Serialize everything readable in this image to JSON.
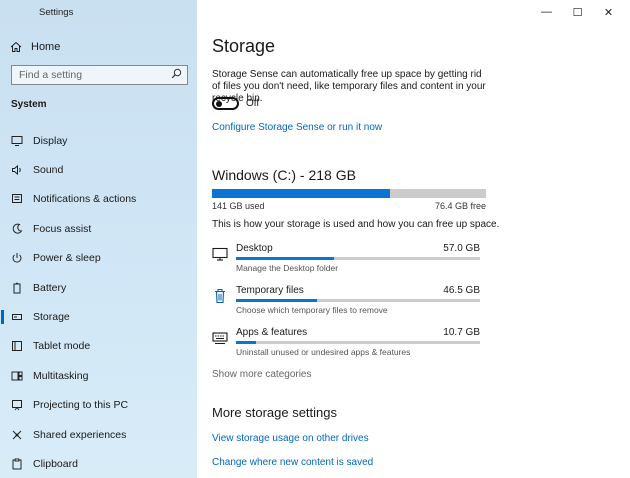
{
  "window": {
    "title": "Settings",
    "controls": {
      "minimize": "—",
      "maximize": "☐",
      "close": "✕"
    }
  },
  "sidebar": {
    "home_label": "Home",
    "search_placeholder": "Find a setting",
    "section_label": "System",
    "items": [
      {
        "label": "Display",
        "icon": "display-icon"
      },
      {
        "label": "Sound",
        "icon": "sound-icon"
      },
      {
        "label": "Notifications & actions",
        "icon": "notifications-icon"
      },
      {
        "label": "Focus assist",
        "icon": "focus-assist-icon"
      },
      {
        "label": "Power & sleep",
        "icon": "power-icon"
      },
      {
        "label": "Battery",
        "icon": "battery-icon"
      },
      {
        "label": "Storage",
        "icon": "storage-icon",
        "active": true
      },
      {
        "label": "Tablet mode",
        "icon": "tablet-icon"
      },
      {
        "label": "Multitasking",
        "icon": "multitasking-icon"
      },
      {
        "label": "Projecting to this PC",
        "icon": "projecting-icon"
      },
      {
        "label": "Shared experiences",
        "icon": "shared-icon"
      },
      {
        "label": "Clipboard",
        "icon": "clipboard-icon"
      }
    ]
  },
  "main": {
    "title": "Storage",
    "description": "Storage Sense can automatically free up space by getting rid of files you don't need, like temporary files and content in your recycle bin.",
    "toggle": {
      "state_label": "Off",
      "on": false
    },
    "configure_link": "Configure Storage Sense or run it now",
    "drive": {
      "title": "Windows (C:) - 218 GB",
      "used_label": "141 GB used",
      "free_label": "76.4 GB free",
      "used_fraction": 0.65
    },
    "usage_description": "This is how your storage is used and how you can free up space.",
    "categories": [
      {
        "name": "Desktop",
        "size": "57.0 GB",
        "subtitle": "Manage the Desktop folder",
        "fraction": 0.4,
        "icon": "monitor-icon"
      },
      {
        "name": "Temporary files",
        "size": "46.5 GB",
        "subtitle": "Choose which temporary files to remove",
        "fraction": 0.33,
        "icon": "trash-icon"
      },
      {
        "name": "Apps & features",
        "size": "10.7 GB",
        "subtitle": "Uninstall unused or undesired apps & features",
        "fraction": 0.08,
        "icon": "keyboard-icon"
      }
    ],
    "show_more": "Show more categories",
    "more_title": "More storage settings",
    "links": [
      "View storage usage on other drives",
      "Change where new content is saved"
    ]
  }
}
